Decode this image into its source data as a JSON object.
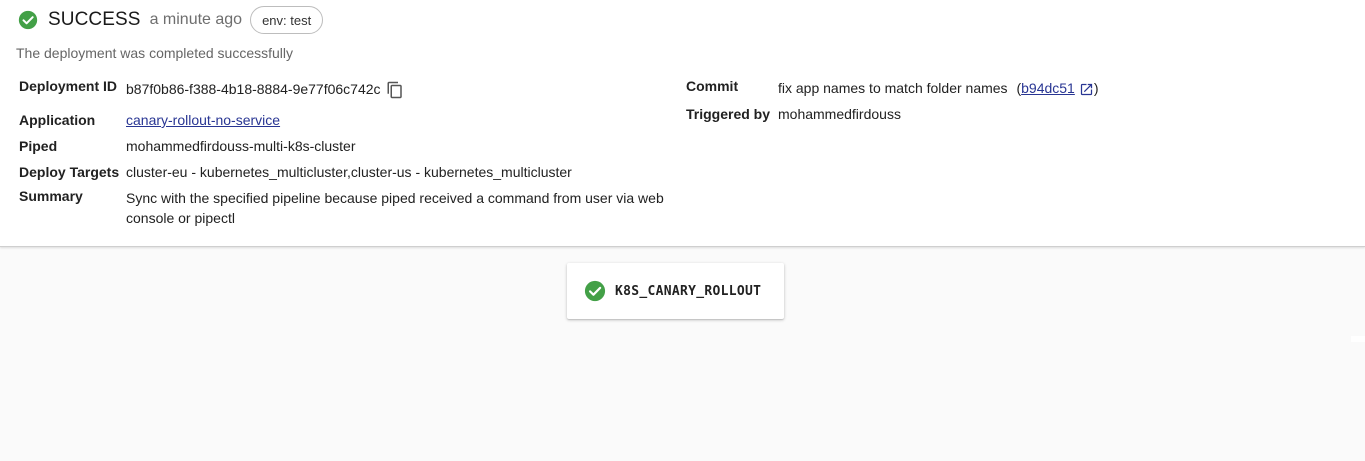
{
  "header": {
    "status": "SUCCESS",
    "time_ago": "a minute ago",
    "env_chip": "env: test",
    "description": "The deployment was completed successfully",
    "status_color": "#4caf50",
    "status_icon": "check-circle-icon"
  },
  "details": {
    "deployment_id_label": "Deployment ID",
    "deployment_id": "b87f0b86-f388-4b18-8884-9e77f06c742c",
    "application_label": "Application",
    "application": "canary-rollout-no-service",
    "piped_label": "Piped",
    "piped": "mohammedfirdouss-multi-k8s-cluster",
    "deploy_targets_label": "Deploy Targets",
    "deploy_targets": "cluster-eu - kubernetes_multicluster,cluster-us - kubernetes_multicluster",
    "summary_label": "Summary",
    "summary": "Sync with the specified pipeline because piped received a command from user via web console or pipectl",
    "commit_label": "Commit",
    "commit_message": "fix app names to match folder names",
    "commit_hash": "b94dc51",
    "triggered_by_label": "Triggered by",
    "triggered_by": "mohammedfirdouss"
  },
  "pipeline": {
    "stages": [
      {
        "name": "K8S_CANARY_ROLLOUT",
        "status_icon": "check-circle-icon"
      }
    ]
  },
  "colors": {
    "success": "#43a047",
    "link": "#283593",
    "background": "#fafafa"
  }
}
